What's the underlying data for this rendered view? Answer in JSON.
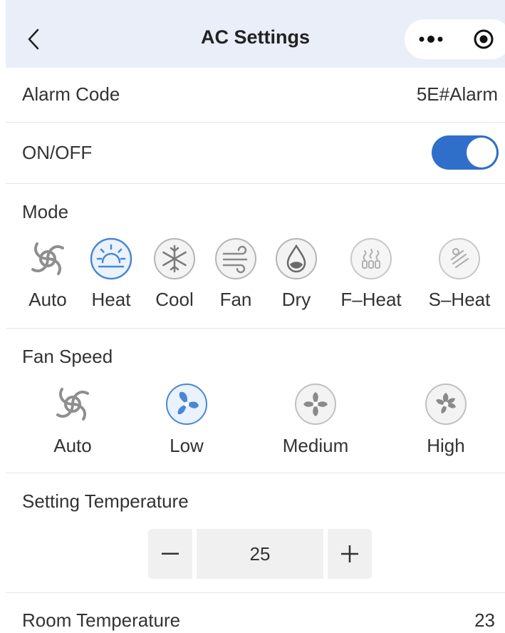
{
  "header": {
    "title": "AC Settings"
  },
  "alarm": {
    "label": "Alarm Code",
    "value": "5E#Alarm"
  },
  "power": {
    "label": "ON/OFF",
    "on": true
  },
  "mode": {
    "label": "Mode",
    "selected": "Heat",
    "options": [
      {
        "label": "Auto",
        "icon": "swirl-icon"
      },
      {
        "label": "Heat",
        "icon": "sun-icon"
      },
      {
        "label": "Cool",
        "icon": "snowflake-icon"
      },
      {
        "label": "Fan",
        "icon": "wind-icon"
      },
      {
        "label": "Dry",
        "icon": "droplet-icon"
      },
      {
        "label": "F–Heat",
        "icon": "floor-heat-icon"
      },
      {
        "label": "S–Heat",
        "icon": "steam-heat-icon"
      }
    ]
  },
  "fan_speed": {
    "label": "Fan Speed",
    "selected": "Low",
    "options": [
      {
        "label": "Auto",
        "icon": "swirl-icon"
      },
      {
        "label": "Low",
        "icon": "fan-low-icon"
      },
      {
        "label": "Medium",
        "icon": "fan-medium-icon"
      },
      {
        "label": "High",
        "icon": "fan-high-icon"
      }
    ]
  },
  "setting_temperature": {
    "label": "Setting Temperature",
    "value": "25",
    "minus": "−",
    "plus": "+"
  },
  "room_temperature": {
    "label": "Room Temperature",
    "value": "23"
  },
  "colors": {
    "accent": "#2f6fc9",
    "icon_selected": "#4a86d6",
    "icon_inactive": "#9a9a9a",
    "header_bg": "#e9eef8"
  }
}
